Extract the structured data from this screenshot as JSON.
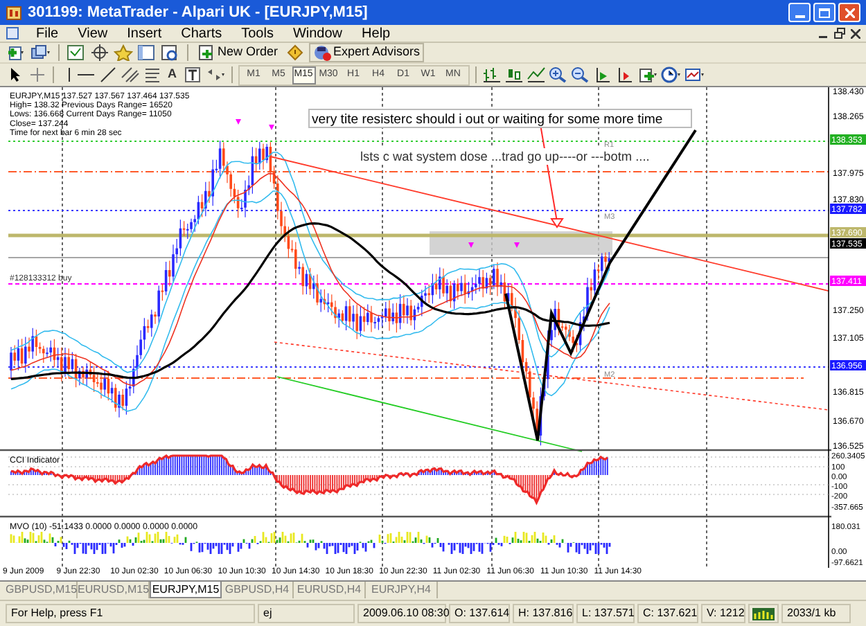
{
  "window": {
    "title": "301199: MetaTrader - Alpari UK - [EURJPY,M15]"
  },
  "menu": [
    "File",
    "View",
    "Insert",
    "Charts",
    "Tools",
    "Window",
    "Help"
  ],
  "toolbar": {
    "new_order": "New Order",
    "expert_advisors": "Expert Advisors",
    "text_tool": "A",
    "timeframes": [
      {
        "label": "M1",
        "selected": false
      },
      {
        "label": "M5",
        "selected": false
      },
      {
        "label": "M15",
        "selected": true
      },
      {
        "label": "M30",
        "selected": false
      },
      {
        "label": "H1",
        "selected": false
      },
      {
        "label": "H4",
        "selected": false
      },
      {
        "label": "D1",
        "selected": false
      },
      {
        "label": "W1",
        "selected": false
      },
      {
        "label": "MN",
        "selected": false
      }
    ]
  },
  "chart": {
    "info_lines": [
      "EURJPY,M15  137.527 137.567 137.464 137.535",
      "High= 138.32    Previous Days Range= 16520",
      "Lows: 136.668    Current Days Range= 11050",
      "Close= 137.244",
      "Time for next bar 6 min 28 sec"
    ],
    "order_label": "#128133312 buy",
    "annotations": [
      "very tite resisterc should i out or waiting for some more time",
      "lsts c wat system dose ...trad go up----or ---botm ...."
    ],
    "pivot_labels": [
      "R1",
      "M3",
      "M2"
    ],
    "price_axis": [
      {
        "label": "138.430",
        "kind": "plain"
      },
      {
        "label": "138.265",
        "kind": "plain"
      },
      {
        "label": "138.353",
        "kind": "tag",
        "color": "#22b022"
      },
      {
        "label": "137.975",
        "kind": "plain"
      },
      {
        "label": "137.830",
        "kind": "plain"
      },
      {
        "label": "137.782",
        "kind": "tag",
        "color": "#1a1aff"
      },
      {
        "label": "137.690",
        "kind": "tag",
        "color": "#bdb76b"
      },
      {
        "label": "137.535",
        "kind": "tag",
        "color": "#000000"
      },
      {
        "label": "137.411",
        "kind": "tag",
        "color": "#ff00ff"
      },
      {
        "label": "137.250",
        "kind": "plain"
      },
      {
        "label": "137.105",
        "kind": "plain"
      },
      {
        "label": "136.956",
        "kind": "tag",
        "color": "#1a1aff"
      },
      {
        "label": "136.815",
        "kind": "plain"
      },
      {
        "label": "136.670",
        "kind": "plain"
      },
      {
        "label": "136.525",
        "kind": "plain"
      }
    ],
    "cci": {
      "title": "CCI Indicator",
      "axis": [
        "260.3405",
        "100",
        "0.00",
        "-100",
        "-200",
        "-357.665"
      ]
    },
    "mvo": {
      "title": "MVO (10) -51.1433 0.0000 0.0000 0.0000 0.0000",
      "axis": [
        "180.031",
        "0.00",
        "-97.6621"
      ]
    },
    "time_axis": [
      "9 Jun 2009",
      "9 Jun 22:30",
      "10 Jun 02:30",
      "10 Jun 06:30",
      "10 Jun 10:30",
      "10 Jun 14:30",
      "10 Jun 18:30",
      "10 Jun 22:30",
      "11 Jun 02:30",
      "11 Jun 06:30",
      "11 Jun 10:30",
      "11 Jun 14:30"
    ]
  },
  "tabs": [
    {
      "label": "GBPUSD,M15",
      "selected": false
    },
    {
      "label": "EURUSD,M15",
      "selected": false
    },
    {
      "label": "EURJPY,M15",
      "selected": true
    },
    {
      "label": "GBPUSD,H4",
      "selected": false
    },
    {
      "label": "EURUSD,H4",
      "selected": false
    },
    {
      "label": "EURJPY,H4",
      "selected": false
    }
  ],
  "status_bar": {
    "help": "For Help, press F1",
    "profile": "ej",
    "time": "2009.06.10 08:30",
    "open": "O: 137.614",
    "high": "H: 137.816",
    "low": "L: 137.571",
    "close": "C: 137.621",
    "volume": "V: 1212",
    "traffic": "2033/1 kb"
  }
}
